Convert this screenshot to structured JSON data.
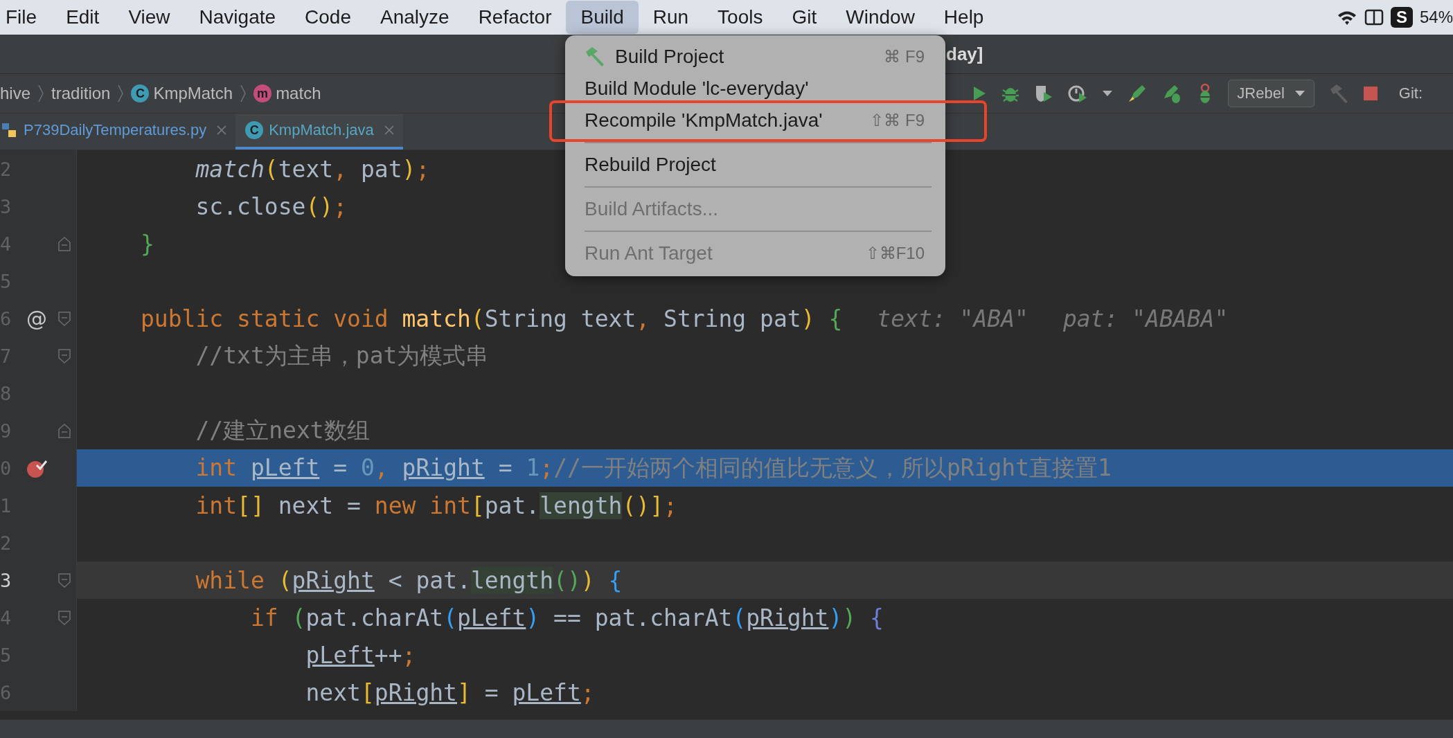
{
  "menubar": {
    "items": [
      {
        "label": "File",
        "selected": false
      },
      {
        "label": "Edit",
        "selected": false
      },
      {
        "label": "View",
        "selected": false
      },
      {
        "label": "Navigate",
        "selected": false
      },
      {
        "label": "Code",
        "selected": false
      },
      {
        "label": "Analyze",
        "selected": false
      },
      {
        "label": "Refactor",
        "selected": false
      },
      {
        "label": "Build",
        "selected": true
      },
      {
        "label": "Run",
        "selected": false
      },
      {
        "label": "Tools",
        "selected": false
      },
      {
        "label": "Git",
        "selected": false
      },
      {
        "label": "Window",
        "selected": false
      },
      {
        "label": "Help",
        "selected": false
      }
    ],
    "tray": [
      {
        "kind": "wifi"
      },
      {
        "kind": "layout"
      },
      {
        "kind": "letter",
        "text": "S"
      },
      {
        "kind": "text",
        "text": "54%"
      }
    ]
  },
  "window": {
    "title": "day]"
  },
  "breadcrumbs": [
    {
      "label": "hive"
    },
    {
      "label": "tradition"
    },
    {
      "label": "KmpMatch",
      "badge": "C",
      "kind": "class"
    },
    {
      "label": "match",
      "badge": "m",
      "kind": "method"
    }
  ],
  "toolbar": [
    {
      "kind": "run"
    },
    {
      "kind": "debug"
    },
    {
      "kind": "coverage"
    },
    {
      "kind": "profile"
    },
    {
      "kind": "caret"
    },
    {
      "kind": "rocket-run"
    },
    {
      "kind": "rocket-debug"
    },
    {
      "kind": "bug-off"
    },
    {
      "kind": "dropdown",
      "text": "JRebel"
    },
    {
      "kind": "hammer"
    },
    {
      "kind": "stop"
    },
    {
      "kind": "text",
      "text": "Git:"
    }
  ],
  "tabs": [
    {
      "label": "P739DailyTemperatures.py",
      "kind": "python",
      "selected": false
    },
    {
      "label": "KmpMatch.java",
      "kind": "class",
      "badge": "C",
      "selected": true
    }
  ],
  "editor": {
    "lines": [
      {
        "number": "2",
        "current": false,
        "caret": false,
        "tokens": [
          {
            "text": "    match",
            "kind": "call"
          },
          {
            "text": "(",
            "kind": "b1"
          },
          {
            "text": "text",
            "kind": "p"
          },
          {
            "text": ", ",
            "kind": "kw"
          },
          {
            "text": "pat",
            "kind": "p"
          },
          {
            "text": ")",
            "kind": "b1"
          },
          {
            "text": ";",
            "kind": "kw"
          }
        ]
      },
      {
        "number": "3",
        "current": false,
        "caret": false,
        "tokens": [
          {
            "text": "    sc.close",
            "kind": "p"
          },
          {
            "text": "()",
            "kind": "b1"
          },
          {
            "text": ";",
            "kind": "kw"
          }
        ]
      },
      {
        "number": "4",
        "current": false,
        "caret": false,
        "gutter": [
          {
            "kind": "fold-end"
          }
        ],
        "tokens": [
          {
            "text": "}",
            "kind": "b2"
          }
        ]
      },
      {
        "number": "5",
        "current": false,
        "caret": false
      },
      {
        "number": "6",
        "current": false,
        "caret": false,
        "gutter": [
          {
            "kind": "override",
            "text": "@"
          },
          {
            "kind": "fold-start"
          }
        ],
        "tokens": [
          {
            "text": "public static void ",
            "kind": "kw"
          },
          {
            "text": "match",
            "kind": "fn"
          },
          {
            "text": "(",
            "kind": "b1"
          },
          {
            "text": "String text",
            "kind": "p"
          },
          {
            "text": ", ",
            "kind": "kw"
          },
          {
            "text": "String pat",
            "kind": "p"
          },
          {
            "text": ")",
            "kind": "b1"
          },
          {
            "text": " {",
            "kind": "b2"
          }
        ],
        "hints": [
          "text: \"ABA\"",
          "pat: \"ABABA\""
        ]
      },
      {
        "number": "7",
        "current": false,
        "caret": false,
        "gutter": [
          {
            "kind": "fold-start"
          }
        ],
        "tokens": [
          {
            "text": "    //txt为主串，pat为模式串",
            "kind": "cm"
          }
        ]
      },
      {
        "number": "8",
        "current": false,
        "caret": false
      },
      {
        "number": "9",
        "current": false,
        "caret": false,
        "gutter": [
          {
            "kind": "fold-end"
          }
        ],
        "tokens": [
          {
            "text": "    //建立next数组",
            "kind": "cm"
          }
        ]
      },
      {
        "number": "0",
        "current": true,
        "caret": false,
        "gutter": [
          {
            "kind": "breakpoint"
          }
        ],
        "tokens": [
          {
            "text": "    int ",
            "kind": "kw"
          },
          {
            "text": "pLeft",
            "kind": "var"
          },
          {
            "text": " = ",
            "kind": "p"
          },
          {
            "text": "0",
            "kind": "num"
          },
          {
            "text": ", ",
            "kind": "kw"
          },
          {
            "text": "pRight",
            "kind": "var"
          },
          {
            "text": " = ",
            "kind": "p"
          },
          {
            "text": "1",
            "kind": "num"
          },
          {
            "text": ";",
            "kind": "kw"
          },
          {
            "text": "//一开始两个相同的值比无意义，所以pRight直接置1",
            "kind": "cm"
          }
        ]
      },
      {
        "number": "1",
        "current": false,
        "caret": false,
        "tokens": [
          {
            "text": "    int",
            "kind": "kw"
          },
          {
            "text": "[]",
            "kind": "b1"
          },
          {
            "text": " next = ",
            "kind": "p"
          },
          {
            "text": "new int",
            "kind": "kw"
          },
          {
            "text": "[",
            "kind": "b1"
          },
          {
            "text": "pat.",
            "kind": "p"
          },
          {
            "text": "length",
            "kind": "method"
          },
          {
            "text": "()",
            "kind": "b1"
          },
          {
            "text": "]",
            "kind": "b1"
          },
          {
            "text": ";",
            "kind": "kw"
          }
        ]
      },
      {
        "number": "2",
        "current": false,
        "caret": false
      },
      {
        "number": "3",
        "current": false,
        "caret": true,
        "gutter": [
          {
            "kind": "fold-start"
          }
        ],
        "tokens": [
          {
            "text": "    while ",
            "kind": "kw"
          },
          {
            "text": "(",
            "kind": "b1"
          },
          {
            "text": "pRight",
            "kind": "var"
          },
          {
            "text": " < pat.",
            "kind": "p"
          },
          {
            "text": "length",
            "kind": "method"
          },
          {
            "text": "()",
            "kind": "b2"
          },
          {
            "text": ")",
            "kind": "b1"
          },
          {
            "text": " {",
            "kind": "b3"
          }
        ]
      },
      {
        "number": "4",
        "current": false,
        "caret": false,
        "gutter": [
          {
            "kind": "fold-start"
          }
        ],
        "tokens": [
          {
            "text": "        if ",
            "kind": "kw"
          },
          {
            "text": "(",
            "kind": "b2"
          },
          {
            "text": "pat.charAt",
            "kind": "p"
          },
          {
            "text": "(",
            "kind": "b3"
          },
          {
            "text": "pLeft",
            "kind": "var"
          },
          {
            "text": ")",
            "kind": "b3"
          },
          {
            "text": " == pat.charAt",
            "kind": "p"
          },
          {
            "text": "(",
            "kind": "b3"
          },
          {
            "text": "pRight",
            "kind": "var"
          },
          {
            "text": ")",
            "kind": "b3"
          },
          {
            "text": ")",
            "kind": "b2"
          },
          {
            "text": " {",
            "kind": "b4"
          }
        ]
      },
      {
        "number": "5",
        "current": false,
        "caret": false,
        "tokens": [
          {
            "text": "            pLeft",
            "kind": "var"
          },
          {
            "text": "++",
            "kind": "p"
          },
          {
            "text": ";",
            "kind": "kw"
          }
        ]
      },
      {
        "number": "6",
        "current": false,
        "caret": false,
        "tokens": [
          {
            "text": "            next",
            "kind": "p"
          },
          {
            "text": "[",
            "kind": "b1"
          },
          {
            "text": "pRight",
            "kind": "var"
          },
          {
            "text": "]",
            "kind": "b1"
          },
          {
            "text": " = ",
            "kind": "p"
          },
          {
            "text": "pLeft",
            "kind": "var"
          },
          {
            "text": ";",
            "kind": "kw"
          }
        ]
      }
    ]
  },
  "build_menu": {
    "items": [
      {
        "kind": "icon-item",
        "label": "Build Project",
        "shortcut": "⌘ F9",
        "disabled": false,
        "annotated": false
      },
      {
        "kind": "item",
        "label": "Build Module 'lc-everyday'",
        "disabled": false,
        "annotated": false
      },
      {
        "kind": "item",
        "label": "Recompile 'KmpMatch.java'",
        "shortcut": "⇧⌘ F9",
        "disabled": false,
        "annotated": true
      },
      {
        "kind": "separator"
      },
      {
        "kind": "item",
        "label": "Rebuild Project",
        "disabled": false,
        "annotated": false
      },
      {
        "kind": "separator"
      },
      {
        "kind": "item",
        "label": "Build Artifacts...",
        "disabled": true,
        "annotated": false
      },
      {
        "kind": "separator"
      },
      {
        "kind": "item",
        "label": "Run Ant Target",
        "shortcut": "⇧⌘F10",
        "disabled": true,
        "annotated": false
      }
    ]
  }
}
